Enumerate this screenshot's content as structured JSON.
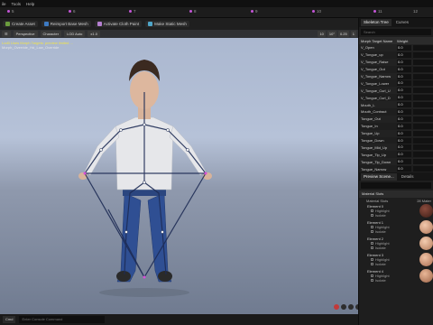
{
  "menu": [
    "ile",
    "Tools",
    "Help"
  ],
  "timeline": {
    "frames": [
      "5",
      "6",
      "7",
      "8",
      "9",
      "10",
      "11",
      "12"
    ]
  },
  "toolbar": {
    "create_asset": "Create Asset",
    "reimport": "Reimport Base Mesh",
    "activate_cloth": "Activate Cloth Paint",
    "make_static": "Make Static Mesh"
  },
  "viewport": {
    "tabs": [
      "Perspective",
      "Character",
      "LOD Auto",
      "x1.0"
    ],
    "right_items": [
      "10",
      "10°",
      "0.25",
      "1"
    ],
    "info_line1": "Lod0 Uses Morph Targets: preview limited ...",
    "info_line2": "Morph_Override_Hd_Low_Override"
  },
  "panel": {
    "tab_skeleton": "Skeleton Tree",
    "tab_curves": "Curves",
    "search_placeholder": "Search",
    "morph_header_name": "Morph Target Name",
    "morph_header_weight": "Weight",
    "morph_targets": [
      {
        "name": "V_Open",
        "weight": "0.0"
      },
      {
        "name": "V_Tongue_up",
        "weight": "0.0"
      },
      {
        "name": "V_Tongue_Raise",
        "weight": "0.0"
      },
      {
        "name": "V_Tongue_Out",
        "weight": "0.0"
      },
      {
        "name": "V_Tongue_Narrow",
        "weight": "0.0"
      },
      {
        "name": "V_Tongue_Lower",
        "weight": "0.0"
      },
      {
        "name": "V_Tongue_Curl_U",
        "weight": "0.0"
      },
      {
        "name": "V_Tongue_Curl_D",
        "weight": "0.0"
      },
      {
        "name": "Mouth_L",
        "weight": "0.0"
      },
      {
        "name": "Mouth_Contract",
        "weight": "0.0"
      },
      {
        "name": "Tongue_Out",
        "weight": "0.0"
      },
      {
        "name": "Tongue_In",
        "weight": "0.0"
      },
      {
        "name": "Tongue_Up",
        "weight": "0.0"
      },
      {
        "name": "Tongue_Down",
        "weight": "0.0"
      },
      {
        "name": "Tongue_Mid_Up",
        "weight": "0.0"
      },
      {
        "name": "Tongue_Tip_Up",
        "weight": "0.0"
      },
      {
        "name": "Tongue_Tip_Down",
        "weight": "0.0"
      },
      {
        "name": "Tongue_Narrow",
        "weight": "0.0"
      }
    ],
    "tab_preview": "Preview Scene...",
    "tab_details": "Details",
    "material_section": "Material Slots",
    "material_sub_left": "Material Slots",
    "material_sub_right": "28 Mater",
    "materials": [
      {
        "name": "Element 0"
      },
      {
        "name": "Element 1"
      },
      {
        "name": "Element 2"
      },
      {
        "name": "Element 3"
      },
      {
        "name": "Element 4"
      }
    ],
    "highlight_label": "Highlight",
    "isolate_label": "Isolate"
  },
  "bottom": {
    "cmd_label": "Cmd",
    "cmd_placeholder": "Enter Console Command"
  }
}
